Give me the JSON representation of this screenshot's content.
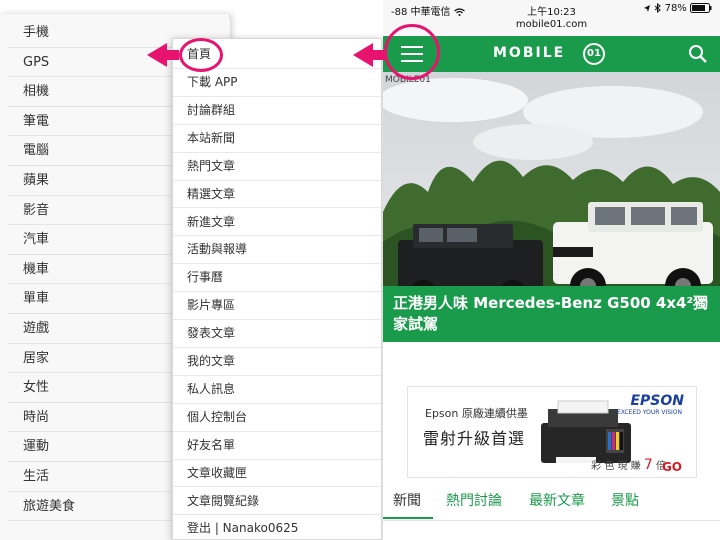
{
  "categories": [
    "手機",
    "GPS",
    "相機",
    "筆電",
    "電腦",
    "蘋果",
    "影音",
    "汽車",
    "機車",
    "單車",
    "遊戲",
    "居家",
    "女性",
    "時尚",
    "運動",
    "生活",
    "旅遊美食"
  ],
  "menu": [
    "首頁",
    "下載 APP",
    "討論群組",
    "本站新聞",
    "熱門文章",
    "精選文章",
    "新進文章",
    "活動與報導",
    "行事曆",
    "影片專區",
    "發表文章",
    "我的文章",
    "私人訊息",
    "個人控制台",
    "好友名單",
    "文章收藏匣",
    "文章閱覽紀錄",
    "登出 | Nanako0625"
  ],
  "status_bar": {
    "carrier": "-88 中華電信",
    "time": "上午10:23",
    "battery": "78%"
  },
  "url": "mobile01.com",
  "header": {
    "logo": "MOBILE",
    "logo_badge": "01"
  },
  "hero": {
    "tag": "MOBILE01",
    "caption": "正港男人味 Mercedes-Benz G500 4x4²獨家試駕"
  },
  "ad": {
    "brand": "Epson 原廠連續供墨",
    "headline": "雷射升級首選",
    "logo": "EPSON",
    "logo_sub": "EXCEED YOUR VISION",
    "promo": "彩 色 現 賺",
    "promo_number": "7",
    "promo_unit": "倍",
    "go": "GO"
  },
  "tabs": [
    "新聞",
    "熱門討論",
    "最新文章",
    "景點"
  ],
  "colors": {
    "accent": "#e8126f",
    "brand_green": "#1a9b4b",
    "epson_blue": "#1b3fa2"
  }
}
